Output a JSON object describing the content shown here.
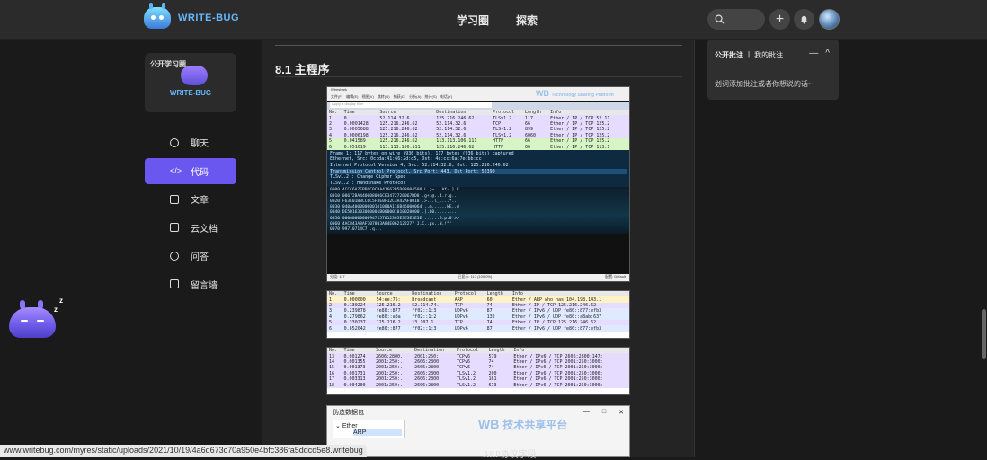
{
  "header": {
    "brand": "WRITE-BUG",
    "nav": [
      "学习圈",
      "探索"
    ],
    "plus_glyph": "+"
  },
  "sidebar": {
    "card_badge": "公开学习圈",
    "card_brand": "WRITE-BUG",
    "items": [
      {
        "label": "聊天",
        "icon": "chat-icon"
      },
      {
        "label": "代码",
        "icon": "code-icon",
        "active": true
      },
      {
        "label": "文章",
        "icon": "article-icon"
      },
      {
        "label": "云文档",
        "icon": "folder-icon"
      },
      {
        "label": "问答",
        "icon": "question-icon"
      },
      {
        "label": "留言墙",
        "icon": "edit-icon"
      }
    ]
  },
  "article": {
    "section_title": "8.1 主程序",
    "caption": "ARP协议字段"
  },
  "wireshark": {
    "title": "Wireshark",
    "menu": [
      "文件(F)",
      "编辑(E)",
      "视图(V)",
      "跳转(G)",
      "捕获(C)",
      "分析(A)",
      "统计(S)",
      "电话(Y)"
    ],
    "filter_placeholder": "Apply a display filter",
    "columns": [
      "No.",
      "Time",
      "Source",
      "Destination",
      "Protocol",
      "Length",
      "Info"
    ],
    "rows": [
      [
        "1",
        "0",
        "52.114.32.6",
        "125.216.246.62",
        "TLSv1.2",
        "117",
        "Ether / IP / TCP 52.11"
      ],
      [
        "2",
        "0.0001428",
        "125.216.246.62",
        "52.114.32.6",
        "TCP",
        "66",
        "Ether / IP / TCP 125.2"
      ],
      [
        "3",
        "0.0005688",
        "125.216.246.62",
        "52.114.32.6",
        "TLSv1.2",
        "899",
        "Ether / IP / TCP 125.2"
      ],
      [
        "4",
        "0.0006198",
        "125.216.246.62",
        "52.114.32.6",
        "TLSv1.2",
        "6060",
        "Ether / IP / TCP 125.2"
      ],
      [
        "5",
        "0.041589",
        "125.216.246.62",
        "113.113.106.111",
        "HTTP",
        "66",
        "Ether / IP / TCP 125.2"
      ],
      [
        "6",
        "0.051019",
        "113.113.106.111",
        "125.216.246.62",
        "HTTP",
        "66",
        "Ether / IP / TCP 113.1"
      ]
    ],
    "details": [
      "Frame 1: 117 bytes on wire (936 bits), 117 bytes (936 bits) captured",
      "Ethernet, Src: 0c:da:41:66:2d:d5, Dst: 4c:cc:6a:7e:bb:cc",
      "Internet Protocol Version 4, Src: 52.114.32.6, Dst: 125.216.246.62",
      "Transmission Control Protocol, Src Port: 443, Dst Port: 52390",
      "TLSv1.2 : Change Cipher Spec",
      "TLSv1.2 : Handshake Protocol"
    ],
    "hex": [
      "0000  4CCC6A7EBBCC0CDA41662D5D08004500  L.j~...Af-.].E.",
      "0010  00672BA440008006CE3472720067DD8  .g+.@..4.r.g..",
      "0020  F63E01BBCC6C5F8E0F12C3A42AF8018  .>...l_....*..",
      "0030  040A400000000101080A116B45000064  ..@......kE..d",
      "0040  DE5D16303000001B000001010020000  .].00.........",
      "0050  00000000000947157012305E3E3E3E3E  ......G.p.0^>>",
      "0060  4AC843A8AF707803A84E062122277  J.C..px..N.!\"'",
      "0070  99710714C7  .q..."
    ],
    "status_left": "分组: 117",
    "status_mid": "已显示: 117 (100.0%)",
    "status_right": "配置: Default"
  },
  "table2": {
    "columns": [
      "No.",
      "Time",
      "Source",
      "Destination",
      "Protocol",
      "Length",
      "Info"
    ],
    "rows": [
      [
        "1",
        "0.000000",
        "54:ee:75:",
        "Broadcast",
        "ARP",
        "60",
        "Ether / ARP who has 104.198.143.1"
      ],
      [
        "2",
        "0.130224",
        "125.216.2",
        "52.114.74.",
        "TCP",
        "74",
        "Ether / IP / TCP 125.216.246.62"
      ],
      [
        "3",
        "0.239878",
        "fe80::877",
        "ff02::1:3",
        "UDPv6",
        "87",
        "Ether / IPv6 / UDP fe80::877:efb3"
      ],
      [
        "4",
        "0.279862",
        "fe80::a8a",
        "ff02::1:2",
        "UDPv6",
        "132",
        "Ether / IPv6 / UDP fe80::a8ab:637"
      ],
      [
        "5",
        "0.330237",
        "125.216.2",
        "13.107.1.",
        "TCP",
        "74",
        "Ether / IP / TCP 125.216.246.62"
      ],
      [
        "6",
        "0.652042",
        "fe80::877",
        "ff02::1:3",
        "UDPv6",
        "87",
        "Ether / IPv6 / UDP fe80::877:efb3"
      ]
    ]
  },
  "table3": {
    "columns": [
      "No.",
      "Time",
      "Source",
      "Destination",
      "Protocol",
      "Length",
      "Info"
    ],
    "rows": [
      [
        "13",
        "0.001274",
        "2606:2800.",
        "2001:250:.",
        "TCPv6",
        "579",
        "Ether / IPv6 / TCP 2606:2800:147:"
      ],
      [
        "14",
        "0.001355",
        "2001:250:.",
        "2606:2800.",
        "TCPv6",
        "74",
        "Ether / IPv6 / TCP 2001:250:3000:"
      ],
      [
        "15",
        "0.001373",
        "2001:250:.",
        "2606:2800.",
        "TCPv6",
        "74",
        "Ether / IPv6 / TCP 2001:250:3000:"
      ],
      [
        "16",
        "0.001731",
        "2001:250:.",
        "2606:2800.",
        "TLSv1.2",
        "200",
        "Ether / IPv6 / TCP 2001:250:3000:"
      ],
      [
        "17",
        "0.003313",
        "2001:250:.",
        "2606:2800.",
        "TLSv1.2",
        "161",
        "Ether / IPv6 / TCP 2001:250:3000:"
      ],
      [
        "18",
        "0.004200",
        "2001:250:.",
        "2606:2800.",
        "TLSv1.2",
        "673",
        "Ether / IPv6 / TCP 2001:250:3000:"
      ]
    ]
  },
  "forge": {
    "title": "伪造数据包",
    "tree_root": "Ether",
    "tree_child": "ARP",
    "win_controls": [
      "—",
      "□",
      "✕"
    ]
  },
  "watermark": {
    "line1": "Technology Sharing Platform",
    "line2": "技术共享平台",
    "mark": "WB"
  },
  "right_panel": {
    "tab_public": "公开批注",
    "separator": "|",
    "tab_mine": "我的批注",
    "minus": "—",
    "chevron": "^",
    "hint": "划词添加批注或者你想说的话~"
  },
  "status_url": "www.writebug.com/myres/static/uploads/2021/10/19/4a6d673c70a950e4bfc386fa5ddcd5e8.writebug",
  "colors": {
    "accent": "#6a57f0",
    "brand": "#67b8ff",
    "row_green": "#d7f5c4",
    "row_purple": "#e6dcff",
    "row_blue": "#dfe9ff",
    "row_yellow": "#fff2c6"
  }
}
